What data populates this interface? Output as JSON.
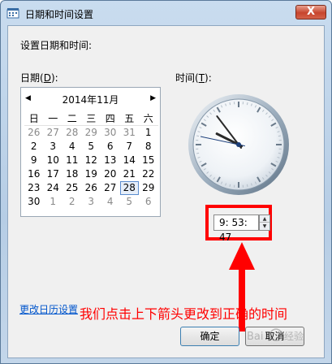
{
  "window": {
    "title": "日期和时间设置",
    "close_glyph": "X"
  },
  "heading": "设置日期和时间:",
  "date_label": {
    "text": "日期(",
    "accel": "D",
    "suffix": "):"
  },
  "time_label": {
    "text": "时间(",
    "accel": "T",
    "suffix": "):"
  },
  "calendar": {
    "title": "2014年11月",
    "prev_glyph": "◀",
    "next_glyph": "▶",
    "weekdays": [
      "日",
      "一",
      "二",
      "三",
      "四",
      "五",
      "六"
    ],
    "weeks": [
      [
        [
          "26",
          true
        ],
        [
          "27",
          true
        ],
        [
          "28",
          true
        ],
        [
          "29",
          true
        ],
        [
          "30",
          true
        ],
        [
          "31",
          true
        ],
        [
          "1",
          false
        ]
      ],
      [
        [
          "2",
          false
        ],
        [
          "3",
          false
        ],
        [
          "4",
          false
        ],
        [
          "5",
          false
        ],
        [
          "6",
          false
        ],
        [
          "7",
          false
        ],
        [
          "8",
          false
        ]
      ],
      [
        [
          "9",
          false
        ],
        [
          "10",
          false
        ],
        [
          "11",
          false
        ],
        [
          "12",
          false
        ],
        [
          "13",
          false
        ],
        [
          "14",
          false
        ],
        [
          "15",
          false
        ]
      ],
      [
        [
          "16",
          false
        ],
        [
          "17",
          false
        ],
        [
          "18",
          false
        ],
        [
          "19",
          false
        ],
        [
          "20",
          false
        ],
        [
          "21",
          false
        ],
        [
          "22",
          false
        ]
      ],
      [
        [
          "23",
          false
        ],
        [
          "24",
          false
        ],
        [
          "25",
          false
        ],
        [
          "26",
          false
        ],
        [
          "27",
          false
        ],
        [
          "28",
          false
        ],
        [
          "29",
          false
        ]
      ],
      [
        [
          "30",
          false
        ],
        [
          "1",
          true
        ],
        [
          "2",
          true
        ],
        [
          "3",
          true
        ],
        [
          "4",
          true
        ],
        [
          "5",
          true
        ],
        [
          "6",
          true
        ]
      ]
    ],
    "selected_day": "28"
  },
  "clock": {
    "hour": 9,
    "minute": 53,
    "second": 47
  },
  "time_value": "9: 53: 47",
  "spin": {
    "up_glyph": "▲",
    "down_glyph": "▼"
  },
  "change_calendar_link": "更改日历设置",
  "annotation": "我们点击上下箭头更改到正确的时间",
  "ok_label": "确定",
  "cancel_label": "取消",
  "colors": {
    "annotation": "#ff0000",
    "link": "#0055cc",
    "highlight": "#ff0000"
  },
  "watermark": "Baidu 经验"
}
